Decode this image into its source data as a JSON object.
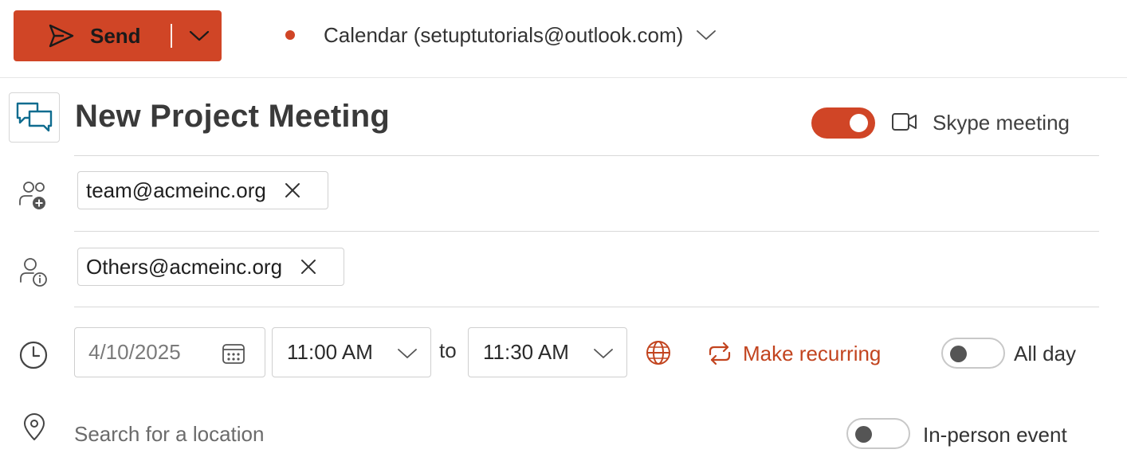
{
  "toolbar": {
    "send_label": "Send",
    "calendar_label": "Calendar (setuptutorials@outlook.com)"
  },
  "event": {
    "title": "New Project Meeting",
    "skype": {
      "label": "Skype meeting",
      "enabled": true
    },
    "required_attendees": [
      {
        "email": "team@acmeinc.org"
      }
    ],
    "optional_attendees": [
      {
        "email": "Others@acmeinc.org"
      }
    ],
    "date": "4/10/2025",
    "start_time": "11:00 AM",
    "to_label": "to",
    "end_time": "11:30 AM",
    "recurring_label": "Make recurring",
    "all_day": {
      "label": "All day",
      "enabled": false
    },
    "location": {
      "placeholder": "Search for a location",
      "value": ""
    },
    "in_person": {
      "label": "In-person event",
      "enabled": false
    }
  },
  "icons": {
    "send": "send-icon",
    "event_type": "chat-bubbles-icon",
    "camera": "video-camera-icon",
    "required": "people-add-icon",
    "optional": "person-info-icon",
    "clock": "clock-icon",
    "calendar": "calendar-icon",
    "globe": "globe-icon",
    "recurring": "repeat-icon",
    "location": "location-pin-icon"
  },
  "colors": {
    "accent": "#d04526",
    "link": "#c2441f",
    "teal": "#0f6c8f"
  }
}
